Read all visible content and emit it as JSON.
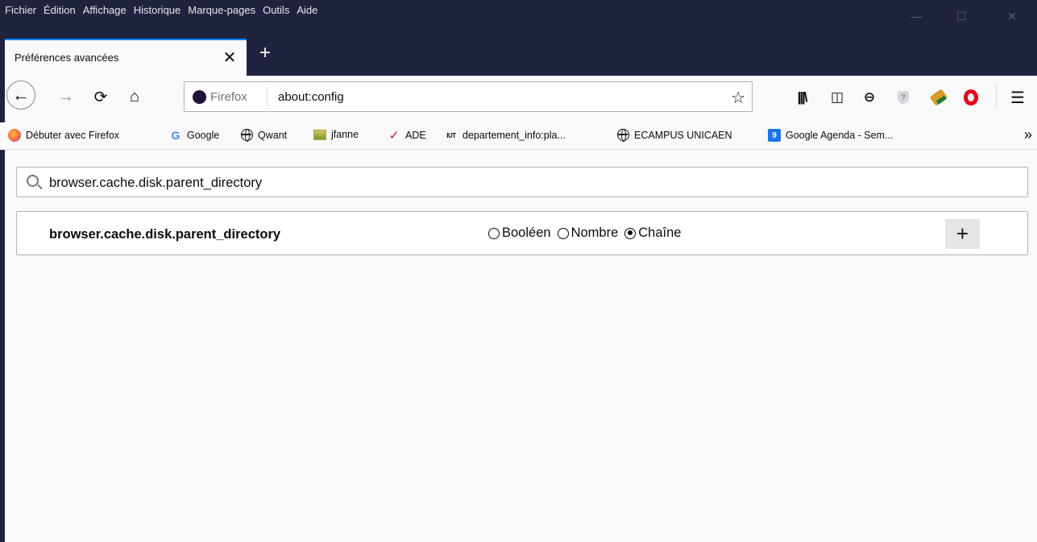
{
  "menubar": {
    "items": [
      "Fichier",
      "Édition",
      "Affichage",
      "Historique",
      "Marque-pages",
      "Outils",
      "Aide"
    ],
    "window_controls": {
      "minimize": "—",
      "maximize": "☐",
      "close": "✕"
    }
  },
  "tab": {
    "title": "Préférences avancées",
    "close": "✕",
    "new_tab": "+"
  },
  "nav": {
    "back": "←",
    "forward": "→",
    "reload": "⟳",
    "home": "⌂",
    "identity_label": "Firefox",
    "url": "about:config",
    "bookmark_star": "☆"
  },
  "toolbar": {
    "library": "|||\\",
    "sidebar": "◫",
    "account": "⊖",
    "extension_shield": "?",
    "menu": "☰"
  },
  "bookmarks": {
    "items": [
      {
        "label": "Débuter avec Firefox",
        "icon": "firefox-icon"
      },
      {
        "label": "Google",
        "icon": "google-icon",
        "glyph": "G"
      },
      {
        "label": "Qwant",
        "icon": "globe-icon"
      },
      {
        "label": "jfanne",
        "icon": "image-icon"
      },
      {
        "label": "ADE",
        "icon": "ade-icon",
        "glyph": "✓"
      },
      {
        "label": "departement_info:pla...",
        "icon": "iut-icon",
        "glyph": "IUT"
      },
      {
        "label": "ECAMPUS UNICAEN",
        "icon": "globe-icon"
      },
      {
        "label": "Google Agenda - Sem...",
        "icon": "calendar-icon",
        "glyph": "9"
      }
    ],
    "overflow": "»"
  },
  "search": {
    "value": "browser.cache.disk.parent_directory"
  },
  "new_pref": {
    "name": "browser.cache.disk.parent_directory",
    "types": [
      {
        "label": "Booléen",
        "selected": false
      },
      {
        "label": "Nombre",
        "selected": false
      },
      {
        "label": "Chaîne",
        "selected": true
      }
    ],
    "add": "+"
  },
  "colors": {
    "chrome_dark": "#202340",
    "accent": "#0a84ff",
    "page_bg": "#f9f9fa"
  }
}
